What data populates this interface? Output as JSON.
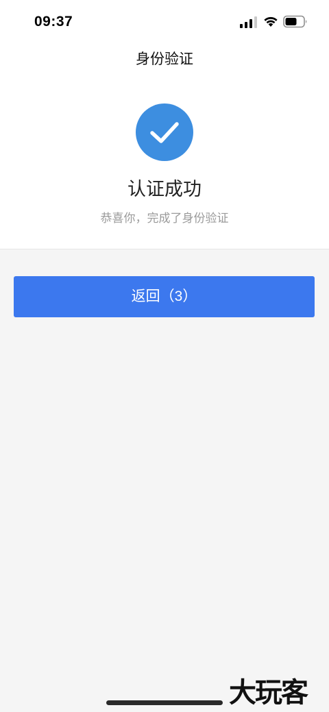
{
  "status_bar": {
    "time": "09:37",
    "signal_icon": "cellular-signal-icon",
    "wifi_icon": "wifi-icon",
    "battery_icon": "battery-icon"
  },
  "header": {
    "title": "身份验证"
  },
  "result": {
    "icon": "checkmark-circle-icon",
    "icon_color": "#3d8ee0",
    "title": "认证成功",
    "subtitle": "恭喜你，完成了身份验证"
  },
  "actions": {
    "back_label": "返回（3）",
    "back_color": "#3c78ee"
  },
  "watermark": {
    "text": "大玩客"
  }
}
